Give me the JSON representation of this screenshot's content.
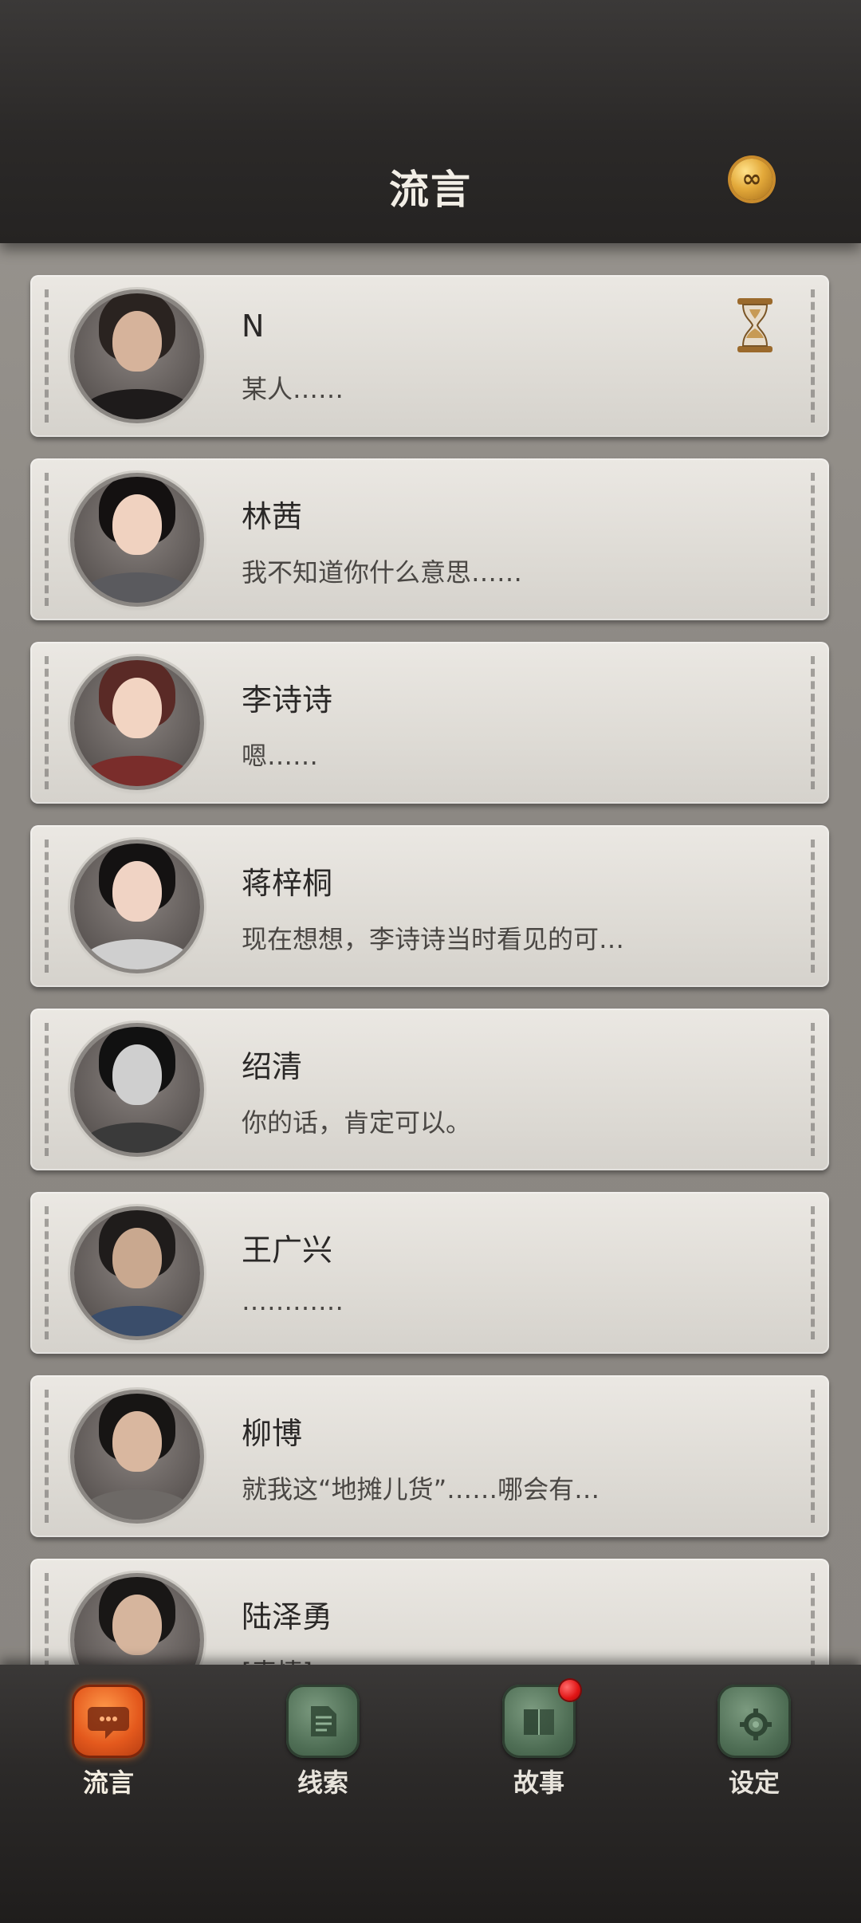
{
  "header": {
    "title": "流言",
    "coin_symbol": "∞",
    "coin_icon": "infinite-coin-icon"
  },
  "contacts": [
    {
      "name": "N",
      "preview": "某人……",
      "hourglass": true,
      "hair": "#2a2320",
      "skin": "#d6b39b",
      "body": "#1e1b1b"
    },
    {
      "name": "林茜",
      "preview": "我不知道你什么意思……",
      "hourglass": false,
      "hair": "#141111",
      "skin": "#f0d2c0",
      "body": "#5a5a5e"
    },
    {
      "name": "李诗诗",
      "preview": "嗯……",
      "hourglass": false,
      "hair": "#5a2a26",
      "skin": "#f2d4c2",
      "body": "#7a2d2b"
    },
    {
      "name": "蒋梓桐",
      "preview": "现在想想，李诗诗当时看见的可…",
      "hourglass": false,
      "hair": "#141212",
      "skin": "#f0d3c4",
      "body": "#cfcfcf"
    },
    {
      "name": "绍清",
      "preview": "你的话，肯定可以。",
      "hourglass": false,
      "hair": "#111111",
      "skin": "#cfcfcf",
      "body": "#3a3a3a"
    },
    {
      "name": "王广兴",
      "preview": "…………",
      "hourglass": false,
      "hair": "#1f1c1b",
      "skin": "#c9a88f",
      "body": "#3a4d6a"
    },
    {
      "name": "柳博",
      "preview": "就我这“地摊儿货”……哪会有…",
      "hourglass": false,
      "hair": "#171514",
      "skin": "#d9b79f",
      "body": "#6d6966"
    },
    {
      "name": "陆泽勇",
      "preview": "[表情]",
      "hourglass": false,
      "hair": "#191716",
      "skin": "#d6b59d",
      "body": "#2b2a2a"
    }
  ],
  "tabs": [
    {
      "label": "流言",
      "icon": "chat-bubble-icon",
      "active": true,
      "badge": false
    },
    {
      "label": "线索",
      "icon": "clue-paper-icon",
      "active": false,
      "badge": false
    },
    {
      "label": "故事",
      "icon": "story-book-icon",
      "active": false,
      "badge": true
    },
    {
      "label": "设定",
      "icon": "settings-gear-icon",
      "active": false,
      "badge": false
    }
  ],
  "colors": {
    "accent_active": "#e4591d",
    "tab_inactive": "#4f6e55",
    "badge_red": "#e01414"
  }
}
